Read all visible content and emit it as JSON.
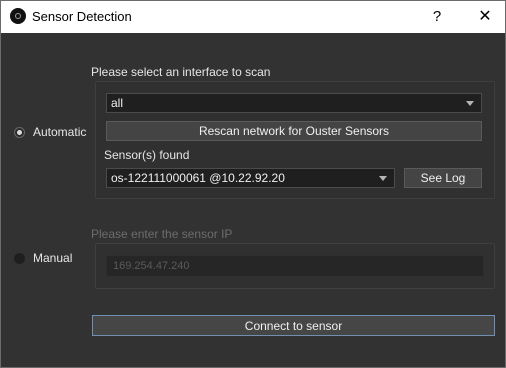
{
  "window": {
    "title": "Sensor Detection",
    "help_label": "?",
    "close_label": "✕"
  },
  "automatic": {
    "radio_label": "Automatic",
    "checked": true,
    "prompt": "Please select an interface to scan",
    "interface": {
      "selected": "all"
    },
    "rescan_label": "Rescan network for Ouster Sensors",
    "found_label": "Sensor(s) found",
    "sensor": {
      "selected": "os-122111000061 @10.22.92.20"
    },
    "see_log_label": "See Log"
  },
  "manual": {
    "radio_label": "Manual",
    "checked": false,
    "prompt": "Please enter the sensor IP",
    "ip_placeholder": "169.254.47.240"
  },
  "connect_label": "Connect to sensor",
  "colors": {
    "background": "#323232",
    "panel": "#303030",
    "focus_border": "#6f8fb3",
    "text": "#e6e6e6",
    "disabled_text": "#6c6c6c"
  }
}
